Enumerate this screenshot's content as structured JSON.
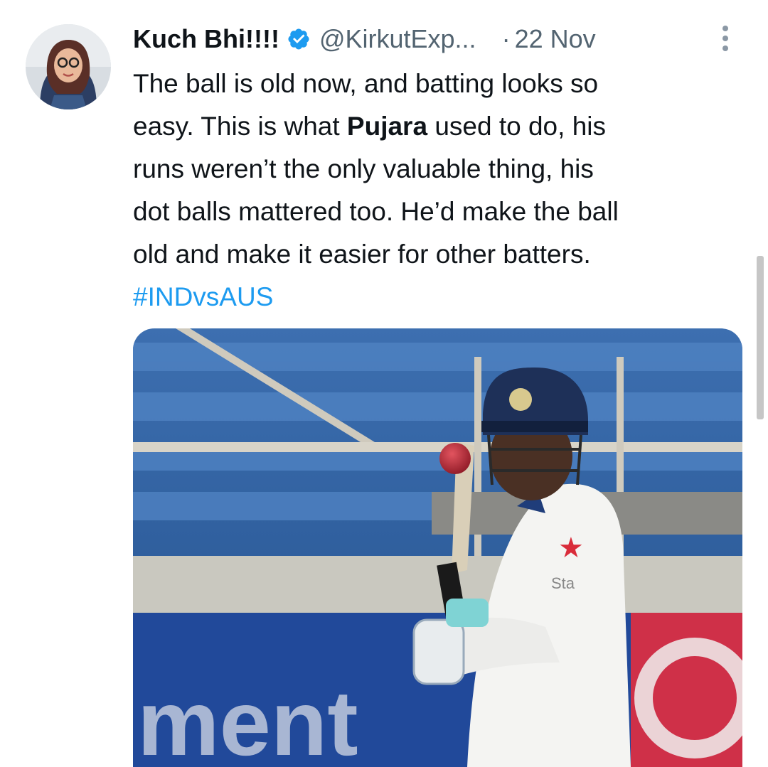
{
  "author": {
    "display_name": "Kuch Bhi!!!!",
    "handle": "@KirkutExp...",
    "verified_icon": "verified-badge-icon",
    "avatar_icon": "avatar-photo"
  },
  "meta": {
    "separator": "·",
    "date": "22 Nov",
    "more_icon": "more-options-icon"
  },
  "text": {
    "l1": "The ball is old now, and batting looks so",
    "l2_pre": "easy. This is what ",
    "l2_bold": "Pujara",
    "l2_post": " used to do, his",
    "l3": "runs weren’t the only valuable thing, his",
    "l4": "dot balls mattered too. He’d make the ball",
    "l5": "old and make it easier for other batters.",
    "hashtag": "#INDvsAUS"
  },
  "media": {
    "banner_text": "ment",
    "sponsor_text": "Sta"
  },
  "colors": {
    "accent": "#1d9bf0",
    "text": "#0f1419",
    "secondary": "#536471"
  }
}
